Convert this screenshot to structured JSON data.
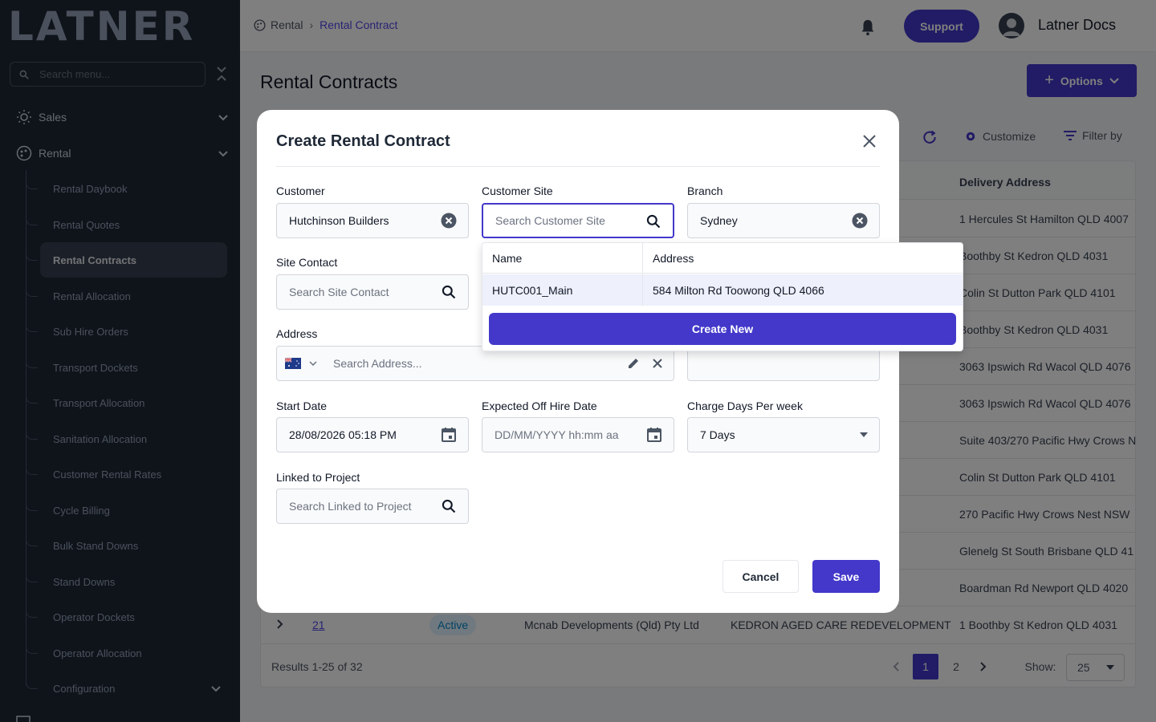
{
  "sidebar": {
    "logo": "LATNER",
    "search_placeholder": "Search menu...",
    "sections": [
      {
        "label": "Sales",
        "icon": "sun-cog-icon"
      },
      {
        "label": "Rental",
        "icon": "palette-icon"
      }
    ],
    "items": [
      {
        "label": "Rental Daybook"
      },
      {
        "label": "Rental Quotes"
      },
      {
        "label": "Rental Contracts",
        "active": true
      },
      {
        "label": "Rental Allocation"
      },
      {
        "label": "Sub Hire Orders"
      },
      {
        "label": "Transport Dockets"
      },
      {
        "label": "Transport Allocation"
      },
      {
        "label": "Sanitation Allocation"
      },
      {
        "label": "Customer Rental Rates"
      },
      {
        "label": "Cycle Billing"
      },
      {
        "label": "Bulk Stand Downs"
      },
      {
        "label": "Stand Downs"
      },
      {
        "label": "Operator Dockets"
      },
      {
        "label": "Operator Allocation"
      },
      {
        "label": "Configuration"
      }
    ]
  },
  "header": {
    "breadcrumb": {
      "root": "Rental",
      "current": "Rental Contract"
    },
    "support_label": "Support",
    "user_name": "Latner Docs"
  },
  "page": {
    "title": "Rental Contracts",
    "options_label": "Options",
    "customize_label": "Customize",
    "filter_label": "Filter by",
    "table": {
      "delivery_header": "Delivery Address",
      "addresses": [
        "1 Hercules St Hamilton QLD 4007",
        "Boothby St Kedron QLD 4031",
        "Colin St Dutton Park QLD 4101",
        "Boothby St Kedron QLD 4031",
        "3063 Ipswich Rd Wacol QLD 4076",
        "3063 Ipswich Rd Wacol QLD 4076",
        "Suite 403/270 Pacific Hwy Crows N",
        "Colin St Dutton Park QLD 4101",
        "270 Pacific Hwy Crows Nest NSW",
        "Glenelg St South Brisbane QLD 41",
        "Boardman Rd Newport QLD 4020"
      ],
      "last_row": {
        "number": "21",
        "status": "Active",
        "customer": "Mcnab Developments (Qld) Pty Ltd",
        "project": "KEDRON AGED CARE REDEVELOPMENT",
        "address": "1 Boothby St Kedron QLD 4031"
      },
      "results_text": "Results 1-25 of 32",
      "pages": [
        "1",
        "2"
      ],
      "show_label": "Show:",
      "show_value": "25"
    }
  },
  "modal": {
    "title": "Create Rental Contract",
    "customer": {
      "label": "Customer",
      "value": "Hutchinson Builders"
    },
    "customer_site": {
      "label": "Customer Site",
      "placeholder": "Search Customer Site"
    },
    "branch": {
      "label": "Branch",
      "value": "Sydney"
    },
    "site_contact": {
      "label": "Site Contact",
      "placeholder": "Search Site Contact"
    },
    "address": {
      "label": "Address",
      "placeholder": "Search Address..."
    },
    "start_date": {
      "label": "Start Date",
      "value": "28/08/2026 05:18 PM"
    },
    "off_hire": {
      "label": "Expected Off Hire Date",
      "placeholder": "DD/MM/YYYY hh:mm aa"
    },
    "charge_days": {
      "label": "Charge Days Per week",
      "value": "7 Days"
    },
    "linked_project": {
      "label": "Linked to Project",
      "placeholder": "Search Linked to Project"
    },
    "cancel_label": "Cancel",
    "save_label": "Save"
  },
  "dropdown": {
    "col_name": "Name",
    "col_address": "Address",
    "row": {
      "name": "HUTC001_Main",
      "address": "584 Milton Rd Toowong QLD 4066"
    },
    "create_label": "Create New"
  },
  "colors": {
    "primary": "#4338ca",
    "sidebar": "#1f2937",
    "active_badge": "#0284c7"
  }
}
